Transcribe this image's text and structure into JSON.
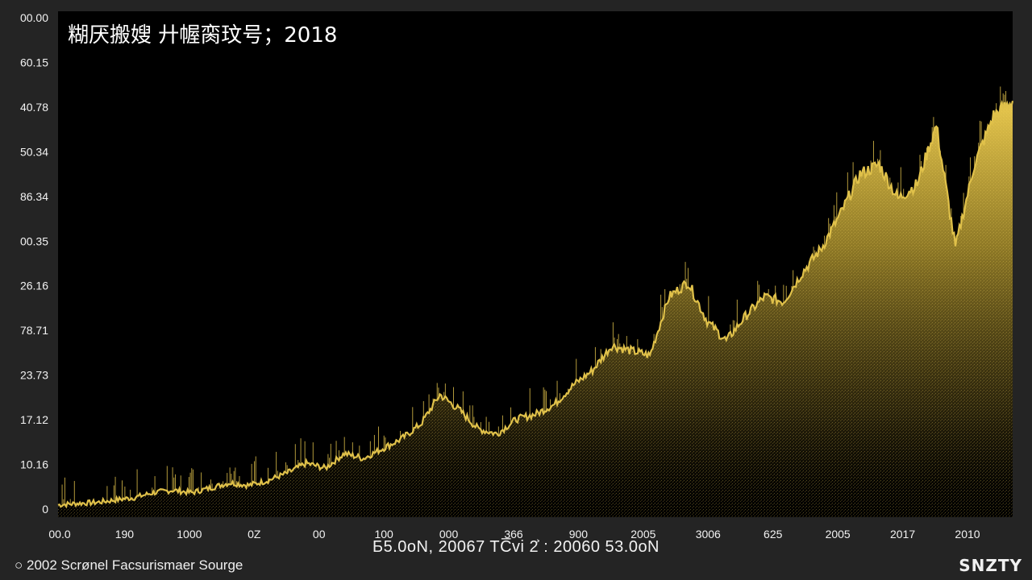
{
  "chart_data": {
    "type": "area",
    "title": "糊厌搬嫂 廾幄脔玟号；2018",
    "y_tick_labels": [
      "00.00",
      "60.15",
      "40.78",
      "50.34",
      "86.34",
      "00.35",
      "26.16",
      "78.71",
      "23.73",
      "17.12",
      "10.16",
      "0"
    ],
    "x_tick_labels": [
      "00.0",
      "190",
      "1000",
      "0Z",
      "00",
      "100",
      "000",
      "366",
      "900",
      "2005",
      "3006",
      "625",
      "2005",
      "2017",
      "2010"
    ],
    "footer_text": "Б5.0oN,  20067   TC̅vi   2͐ : 20060   53.0oN",
    "source_text": "2002 Scrønel Facsurismaer Sourge",
    "logo_text": "SNZTY",
    "colors": {
      "background": "#242424",
      "plot_bg": "#000000",
      "series": "#e0c14a",
      "series_dark": "#6b5a1c",
      "text": "#f2f2f2",
      "axis": "#9a9a9a"
    },
    "ylim": [
      0,
      1
    ],
    "grid": false,
    "series": [
      {
        "x": [
          0,
          0.02,
          0.04,
          0.06,
          0.08,
          0.1,
          0.12,
          0.14,
          0.16,
          0.18,
          0.2,
          0.22,
          0.24,
          0.26,
          0.28,
          0.3,
          0.32,
          0.34,
          0.36,
          0.38,
          0.4,
          0.42,
          0.44,
          0.46,
          0.48,
          0.5,
          0.52,
          0.54,
          0.56,
          0.58,
          0.6,
          0.62,
          0.64,
          0.66,
          0.68,
          0.7,
          0.72,
          0.74,
          0.76,
          0.78,
          0.8,
          0.82,
          0.84,
          0.86,
          0.88,
          0.9,
          0.92,
          0.94,
          0.96,
          0.98,
          1.0
        ],
        "values": [
          0.025,
          0.028,
          0.03,
          0.035,
          0.04,
          0.05,
          0.055,
          0.05,
          0.06,
          0.07,
          0.065,
          0.075,
          0.09,
          0.11,
          0.1,
          0.13,
          0.12,
          0.14,
          0.16,
          0.19,
          0.25,
          0.22,
          0.18,
          0.17,
          0.2,
          0.21,
          0.23,
          0.27,
          0.3,
          0.35,
          0.34,
          0.33,
          0.45,
          0.48,
          0.4,
          0.36,
          0.41,
          0.45,
          0.44,
          0.5,
          0.55,
          0.62,
          0.7,
          0.72,
          0.65,
          0.68,
          0.8,
          0.55,
          0.72,
          0.82,
          0.85
        ]
      }
    ]
  }
}
